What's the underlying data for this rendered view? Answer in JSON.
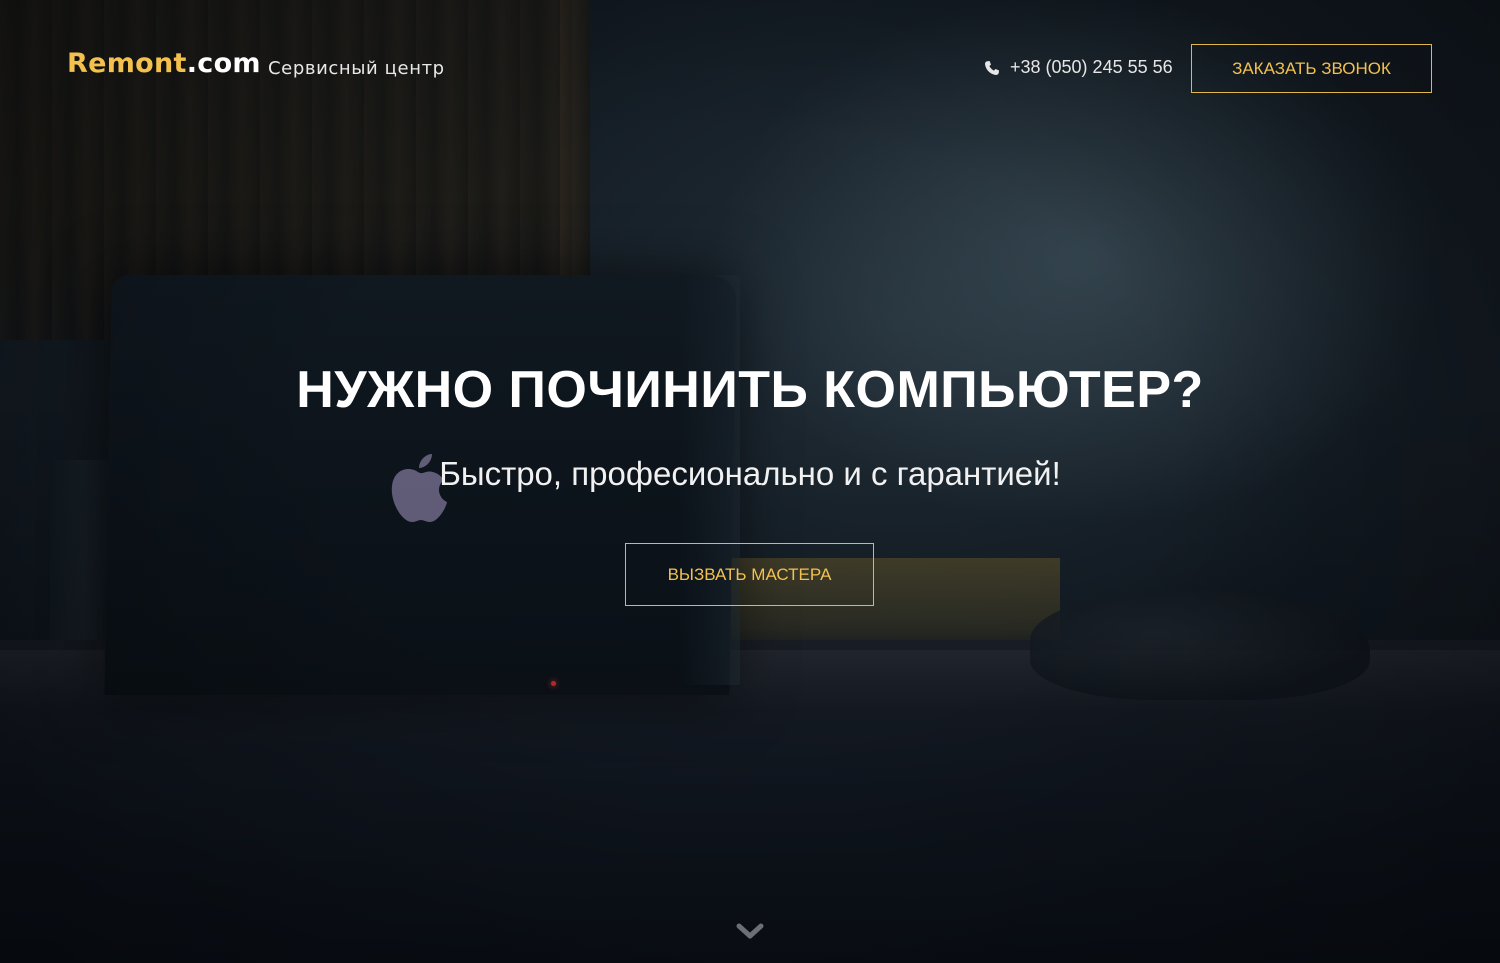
{
  "header": {
    "logo_main": "Remont",
    "logo_tld": ".com",
    "tagline": "Сервисный центр",
    "phone": "+38 (050) 245 55 56",
    "phone_icon": "phone-icon",
    "callback_label": "ЗАКАЗАТЬ ЗВОНОК"
  },
  "hero": {
    "title": "НУЖНО ПОЧИНИТЬ КОМПЬЮТЕР?",
    "subtitle": "Быстро, професионально и с гарантией!",
    "cta_label": "ВЫЗВАТЬ МАСТЕРА",
    "scroll_icon": "chevron-down-icon"
  },
  "colors": {
    "accent": "#f2c14e",
    "text": "#ffffff",
    "background": "#121a22"
  }
}
